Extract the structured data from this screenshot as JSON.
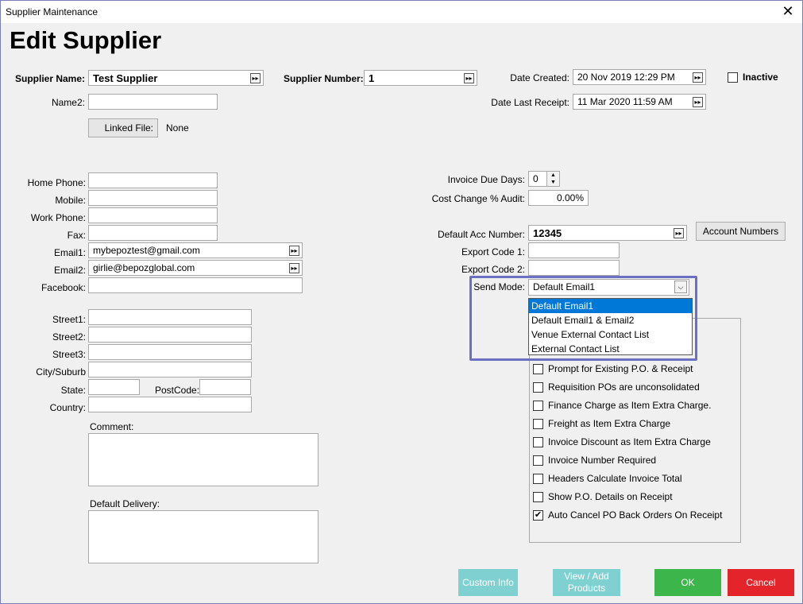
{
  "window": {
    "title": "Supplier Maintenance",
    "close_glyph": "✕"
  },
  "heading": "Edit Supplier",
  "supplier_name": {
    "label": "Supplier Name:",
    "value": "Test Supplier"
  },
  "supplier_number": {
    "label": "Supplier Number:",
    "value": "1"
  },
  "date_created": {
    "label": "Date Created:",
    "value": "20 Nov 2019 12:29 PM"
  },
  "date_last_receipt": {
    "label": "Date Last Receipt:",
    "value": "11 Mar 2020 11:59 AM"
  },
  "inactive": {
    "label": "Inactive",
    "checked": false
  },
  "name2": {
    "label": "Name2:",
    "value": ""
  },
  "linked_file": {
    "button": "Linked File:",
    "value": "None"
  },
  "contact": {
    "home_phone": {
      "label": "Home Phone:",
      "value": ""
    },
    "mobile": {
      "label": "Mobile:",
      "value": ""
    },
    "work_phone": {
      "label": "Work Phone:",
      "value": ""
    },
    "fax": {
      "label": "Fax:",
      "value": ""
    },
    "email1": {
      "label": "Email1:",
      "value": "mybepoztest@gmail.com"
    },
    "email2": {
      "label": "Email2:",
      "value": "girlie@bepozglobal.com"
    },
    "facebook": {
      "label": "Facebook:",
      "value": ""
    }
  },
  "address": {
    "street1": {
      "label": "Street1:",
      "value": ""
    },
    "street2": {
      "label": "Street2:",
      "value": ""
    },
    "street3": {
      "label": "Street3:",
      "value": ""
    },
    "city": {
      "label": "City/Suburb",
      "value": ""
    },
    "state": {
      "label": "State:",
      "value": ""
    },
    "postcode": {
      "label": "PostCode:",
      "value": ""
    },
    "country": {
      "label": "Country:",
      "value": ""
    }
  },
  "comment": {
    "label": "Comment:"
  },
  "default_delivery": {
    "label": "Default Delivery:"
  },
  "invoice_due_days": {
    "label": "Invoice Due Days:",
    "value": "0"
  },
  "cost_change_audit": {
    "label": "Cost Change % Audit:",
    "value": "0.00%"
  },
  "default_acc_number": {
    "label": "Default Acc Number:",
    "value": "12345"
  },
  "account_numbers_button": "Account Numbers",
  "export_code1": {
    "label": "Export Code 1:",
    "value": ""
  },
  "export_code2": {
    "label": "Export Code 2:",
    "value": ""
  },
  "send_mode": {
    "label": "Send Mode:",
    "value": "Default Email1",
    "options": [
      "Default Email1",
      "Default Email1 & Email2",
      "Venue External Contact List",
      "External Contact List"
    ]
  },
  "options": [
    {
      "label": "Prompt for Existing P.O. & Receipt",
      "checked": false
    },
    {
      "label": "Requisition POs are unconsolidated",
      "checked": false
    },
    {
      "label": "Finance Charge as Item Extra Charge.",
      "checked": false
    },
    {
      "label": "Freight as Item Extra Charge",
      "checked": false
    },
    {
      "label": "Invoice Discount as Item Extra Charge",
      "checked": false
    },
    {
      "label": "Invoice Number Required",
      "checked": false
    },
    {
      "label": "Headers Calculate Invoice Total",
      "checked": false
    },
    {
      "label": "Show P.O. Details on Receipt",
      "checked": false
    },
    {
      "label": "Auto Cancel PO Back Orders On Receipt",
      "checked": true
    }
  ],
  "buttons": {
    "custom_info": "Custom Info",
    "view_add_products": "View / Add Products",
    "ok": "OK",
    "cancel": "Cancel"
  },
  "colors": {
    "custom_btn": "#7fd1d1",
    "ok": "#3cb64a",
    "cancel": "#e3242b",
    "highlight": "#6b70c4",
    "selection": "#0078d7"
  },
  "icons": {
    "lookup": "double-chevron-right-icon",
    "dropdown": "chevron-down-icon",
    "check": "✔"
  }
}
